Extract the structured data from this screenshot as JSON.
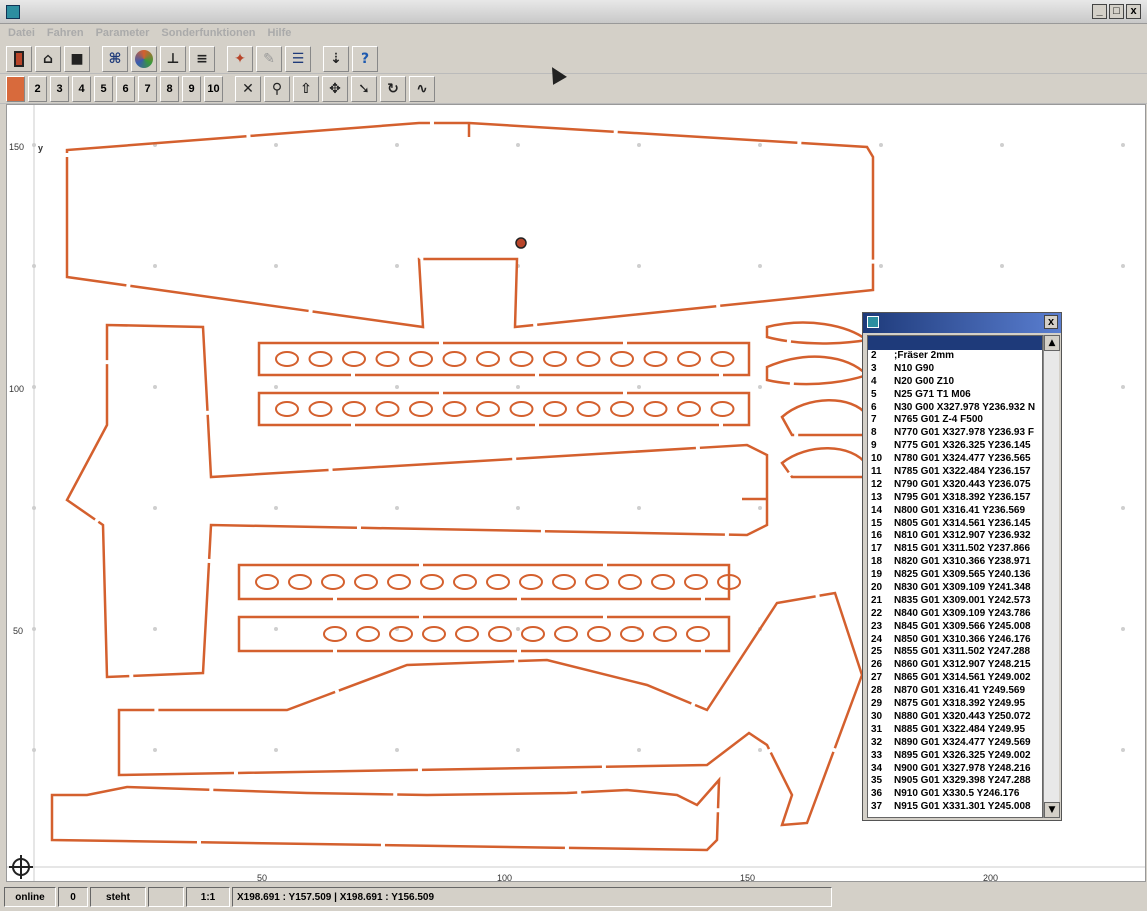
{
  "window": {
    "controls": [
      "_",
      "□",
      "x"
    ]
  },
  "menu": [
    "Datei",
    "Fahren",
    "Parameter",
    "Sonderfunktionen",
    "Hilfe"
  ],
  "toolbar1": [
    "exit-icon",
    "open-folder-icon",
    "save-icon",
    "nodes-icon",
    "color-wheel-icon",
    "anchor-icon",
    "layers-icon",
    "tools-icon",
    "pen-icon",
    "list-icon",
    "spindle-icon",
    "help-icon"
  ],
  "toolbar2_numbers": [
    "2",
    "3",
    "4",
    "5",
    "6",
    "7",
    "8",
    "9",
    "10"
  ],
  "toolbar2_tools": [
    "cancel-icon",
    "zoom-icon",
    "up-icon",
    "move-icon",
    "pointer-icon",
    "rotate-icon",
    "measure-icon"
  ],
  "axes": {
    "y_label": "y",
    "y_ticks": [
      "150",
      "100",
      "50"
    ],
    "x_ticks": [
      "50",
      "100",
      "150",
      "200"
    ]
  },
  "nc_window": {
    "close": "x",
    "rows": [
      {
        "n": "2",
        "t": ";Fräser 2mm"
      },
      {
        "n": "3",
        "t": "N10 G90"
      },
      {
        "n": "4",
        "t": "N20 G00 Z10"
      },
      {
        "n": "5",
        "t": "N25 G71 T1 M06"
      },
      {
        "n": "6",
        "t": "N30 G00 X327.978 Y236.932 N"
      },
      {
        "n": "7",
        "t": "N765 G01 Z-4 F500"
      },
      {
        "n": "8",
        "t": "N770 G01 X327.978 Y236.93 F"
      },
      {
        "n": "9",
        "t": "N775 G01 X326.325 Y236.145"
      },
      {
        "n": "10",
        "t": "N780 G01 X324.477 Y236.565"
      },
      {
        "n": "11",
        "t": "N785 G01 X322.484 Y236.157"
      },
      {
        "n": "12",
        "t": "N790 G01 X320.443 Y236.075"
      },
      {
        "n": "13",
        "t": "N795 G01 X318.392 Y236.157"
      },
      {
        "n": "14",
        "t": "N800 G01 X316.41 Y236.569"
      },
      {
        "n": "15",
        "t": "N805 G01 X314.561 Y236.145"
      },
      {
        "n": "16",
        "t": "N810 G01 X312.907 Y236.932"
      },
      {
        "n": "17",
        "t": "N815 G01 X311.502 Y237.866"
      },
      {
        "n": "18",
        "t": "N820 G01 X310.366 Y238.971"
      },
      {
        "n": "19",
        "t": "N825 G01 X309.565 Y240.136"
      },
      {
        "n": "20",
        "t": "N830 G01 X309.109 Y241.348"
      },
      {
        "n": "21",
        "t": "N835 G01 X309.001 Y242.573"
      },
      {
        "n": "22",
        "t": "N840 G01 X309.109 Y243.786"
      },
      {
        "n": "23",
        "t": "N845 G01 X309.566 Y245.008"
      },
      {
        "n": "24",
        "t": "N850 G01 X310.366 Y246.176"
      },
      {
        "n": "25",
        "t": "N855 G01 X311.502 Y247.288"
      },
      {
        "n": "26",
        "t": "N860 G01 X312.907 Y248.215"
      },
      {
        "n": "27",
        "t": "N865 G01 X314.561 Y249.002"
      },
      {
        "n": "28",
        "t": "N870 G01 X316.41 Y249.569"
      },
      {
        "n": "29",
        "t": "N875 G01 X318.392 Y249.95"
      },
      {
        "n": "30",
        "t": "N880 G01 X320.443 Y250.072"
      },
      {
        "n": "31",
        "t": "N885 G01 X322.484 Y249.95"
      },
      {
        "n": "32",
        "t": "N890 G01 X324.477 Y249.569"
      },
      {
        "n": "33",
        "t": "N895 G01 X326.325 Y249.002"
      },
      {
        "n": "34",
        "t": "N900 G01 X327.978 Y248.216"
      },
      {
        "n": "35",
        "t": "N905 G01 X329.398 Y247.288"
      },
      {
        "n": "36",
        "t": "N910 G01 X330.5 Y246.176"
      },
      {
        "n": "37",
        "t": "N915 G01 X331.301 Y245.008"
      }
    ]
  },
  "status": {
    "mode": "online",
    "count": "0",
    "state": "steht",
    "blank": "",
    "scale": "1:1",
    "coords": "X198.691 : Y157.509  |  X198.691 : Y156.509"
  },
  "colors": {
    "cut_path": "#d4602e",
    "workspace": "#ffffff",
    "chrome": "#d4d0c8",
    "selection": "#1e3a7a"
  }
}
